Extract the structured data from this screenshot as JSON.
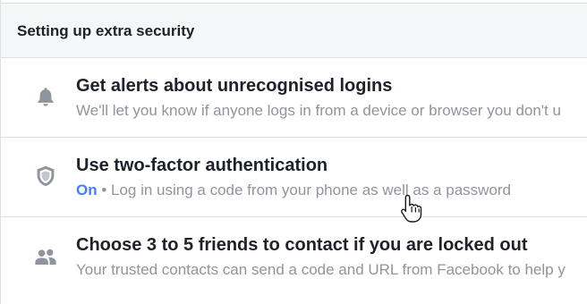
{
  "section": {
    "title": "Setting up extra security"
  },
  "items": [
    {
      "icon": "bell-icon",
      "heading": "Get alerts about unrecognised logins",
      "description": "We'll let you know if anyone logs in from a device or browser you don't u"
    },
    {
      "icon": "shield-icon",
      "heading": "Use two-factor authentication",
      "status": "On",
      "separator": " • ",
      "description": "Log in using a code from your phone as well as a password"
    },
    {
      "icon": "friends-icon",
      "heading": "Choose 3 to 5 friends to contact if you are locked out",
      "description": "Your trusted contacts can send a code and URL from Facebook to help y"
    }
  ],
  "colors": {
    "heading": "#1d2129",
    "muted": "#90949c",
    "status_on": "#4080ff",
    "icon": "#90949c",
    "header_bg": "#f5f6f7",
    "divider": "#dddfe2"
  }
}
